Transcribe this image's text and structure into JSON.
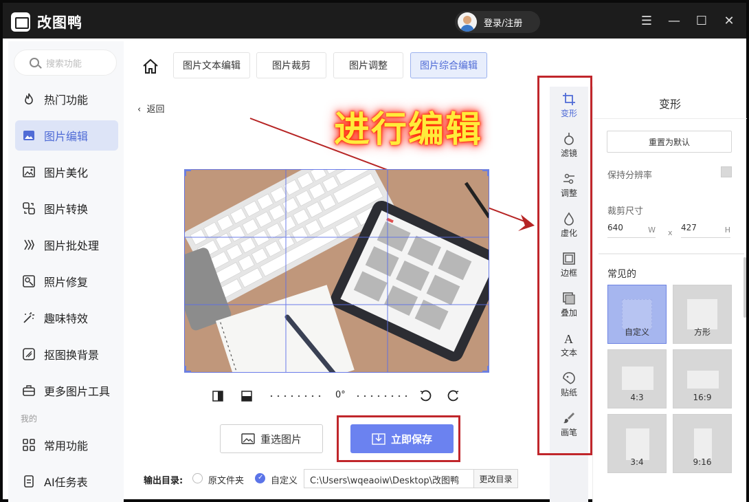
{
  "app": {
    "name": "改图鸭",
    "login_label": "登录/注册"
  },
  "window_controls": {
    "menu": "☰",
    "minimize": "—",
    "maximize": "☐",
    "close": "✕"
  },
  "sidebar": {
    "search_placeholder": "搜索功能",
    "items": [
      {
        "label": "热门功能",
        "icon": "flame-icon"
      },
      {
        "label": "图片编辑",
        "icon": "image-edit-icon",
        "active": true
      },
      {
        "label": "图片美化",
        "icon": "image-beautify-icon"
      },
      {
        "label": "图片转换",
        "icon": "convert-icon"
      },
      {
        "label": "图片批处理",
        "icon": "batch-icon"
      },
      {
        "label": "照片修复",
        "icon": "photo-repair-icon"
      },
      {
        "label": "趣味特效",
        "icon": "magic-wand-icon"
      },
      {
        "label": "抠图换背景",
        "icon": "cutout-icon"
      },
      {
        "label": "更多图片工具",
        "icon": "toolbox-icon"
      }
    ],
    "section_label": "我的",
    "my_items": [
      {
        "label": "常用功能",
        "icon": "grid-icon"
      },
      {
        "label": "AI任务表",
        "icon": "document-icon"
      }
    ]
  },
  "tabs": [
    "图片文本编辑",
    "图片裁剪",
    "图片调整",
    "图片综合编辑"
  ],
  "active_tab": "图片综合编辑",
  "back_label": "返回",
  "annotation_text": "进行编辑",
  "rotation": {
    "angle": "0°"
  },
  "buttons": {
    "reselect": "重选图片",
    "save": "立即保存"
  },
  "output": {
    "label": "输出目录:",
    "option_original": "原文件夹",
    "option_custom": "自定义",
    "path": "C:\\Users\\wqeaoiw\\Desktop\\改图鸭",
    "change_label": "更改目录"
  },
  "tools": [
    {
      "label": "变形",
      "icon": "crop-icon",
      "active": true
    },
    {
      "label": "滤镜",
      "icon": "filter-icon"
    },
    {
      "label": "调整",
      "icon": "adjust-icon"
    },
    {
      "label": "虚化",
      "icon": "blur-drop-icon"
    },
    {
      "label": "边框",
      "icon": "frame-icon"
    },
    {
      "label": "叠加",
      "icon": "overlay-icon"
    },
    {
      "label": "文本",
      "icon": "text-icon"
    },
    {
      "label": "贴纸",
      "icon": "sticker-icon"
    },
    {
      "label": "画笔",
      "icon": "brush-icon"
    }
  ],
  "panel": {
    "title": "变形",
    "reset_label": "重置为默认",
    "keep_resolution_label": "保持分辨率",
    "crop_size_label": "裁剪尺寸",
    "width": "640",
    "width_unit": "W",
    "x_sep": "x",
    "height": "427",
    "height_unit": "H",
    "common_label": "常见的",
    "presets": [
      "自定义",
      "方形",
      "4:3",
      "16:9",
      "3:4",
      "9:16"
    ],
    "active_preset": "自定义"
  },
  "colors": {
    "accent": "#6b82f0",
    "annotation_red": "#c0262b",
    "titlebar": "#1c1c1c"
  }
}
